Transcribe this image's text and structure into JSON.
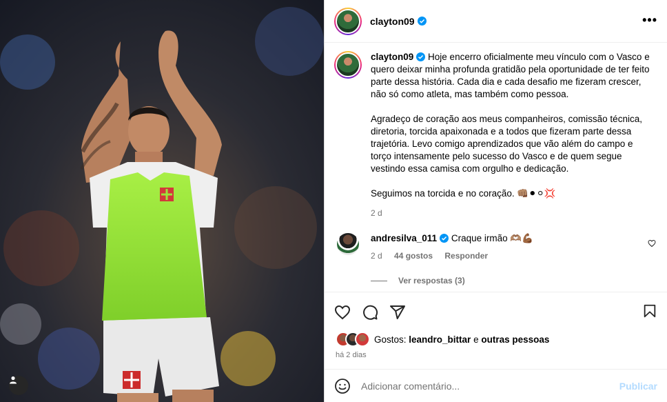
{
  "post": {
    "username": "clayton09",
    "more_label": "•••",
    "user_tag_icon": "person-icon"
  },
  "caption": {
    "username": "clayton09",
    "paragraph1": "Hoje encerro oficialmente meu vínculo com o Vasco e quero deixar minha profunda gratidão pela oportunidade de ter feito parte dessa história. Cada dia e cada desafio me fizeram crescer, não só como atleta, mas também como pessoa.",
    "paragraph2": "Agradeço de coração aos meus companheiros, comissão técnica, diretoria, torcida apaixonada e a todos que fizeram parte dessa trajetória. Levo comigo aprendizados que vão além do campo e torço intensamente pelo sucesso do Vasco e de quem segue vestindo essa camisa com orgulho e dedicação.",
    "paragraph3": "Seguimos na torcida e no coração. 👊🏽⚫⚪💢",
    "time": "2 d"
  },
  "comment": {
    "username": "andresilva_011",
    "text": "Craque irmão 🫶🏽💪🏾",
    "time": "2 d",
    "likes": "44 gostos",
    "reply_label": "Responder",
    "view_replies": "Ver respostas (3)"
  },
  "likes": {
    "prefix": "Gostos: ",
    "user": "leandro_bittar",
    "suffix": " e ",
    "others": "outras pessoas"
  },
  "timestamp": "há 2 dias",
  "add_comment": {
    "placeholder": "Adicionar comentário...",
    "publish_label": "Publicar"
  },
  "colors": {
    "verified": "#0095f6",
    "muted": "#737373",
    "publish_disabled": "#b3dbff",
    "bib": "#9be53a"
  }
}
